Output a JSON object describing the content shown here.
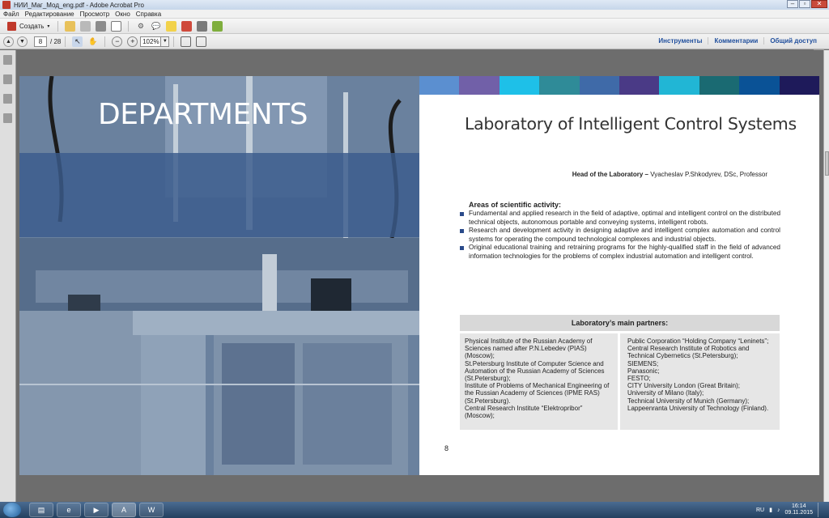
{
  "window": {
    "title": "НИИ_Маг_Мод_eng.pdf - Adobe Acrobat Pro"
  },
  "menu": [
    "Файл",
    "Редактирование",
    "Просмотр",
    "Окно",
    "Справка"
  ],
  "toolbar": {
    "create_label": "Создать"
  },
  "navigation": {
    "current_page": "8",
    "total_pages": "/ 28",
    "zoom": "102%"
  },
  "right_links": [
    "Инструменты",
    "Комментарии",
    "Общий доступ"
  ],
  "left_page": {
    "banner_text": "DEPARTMENTS"
  },
  "right_page": {
    "color_strip": [
      "#5b8fd0",
      "#7160a8",
      "#1ec0e8",
      "#2f8b98",
      "#3f6aa8",
      "#4a3a86",
      "#21b6d5",
      "#1a6a72",
      "#0a5296",
      "#1e1a5a"
    ],
    "title": "Laboratory of Intelligent Control Systems",
    "head_label": "Head of the Laboratory –",
    "head_name": "Vyacheslav P.Shkodyrev, DSc, Professor",
    "areas_title": "Areas of scientific activity:",
    "areas": [
      "Fundamental and applied research in the field of adaptive, optimal and intelligent control on the distributed technical objects, autonomous portable and conveying systems, intelligent robots.",
      "Research and development activity in designing adaptive and intelligent complex automation and control systems for operating the compound technological complexes and industrial objects.",
      "Original educational training and retraining programs for the highly-qualified staff in the field of advanced information technologies for the problems of complex industrial automation and intelligent control."
    ],
    "partners_title": "Laboratory’s main partners:",
    "partners_left": [
      "Physical Institute of the Russian Academy of Sciences named after P.N.Lebedev (PIAS) (Moscow);",
      "St.Petersburg Institute of Computer Science and Automation of the Russian Academy of Sciences (St.Petersburg);",
      "Institute of Problems of Mechanical Engineering of the Russian Academy of Sciences (IPME RAS) (St.Petersburg).",
      "Central Research Institute “Elektropribor” (Moscow);"
    ],
    "partners_right": [
      "Public Corporation “Holding Company “Leninets”;",
      "Central Research Institute of Robotics and Technical Cybernetics (St.Petersburg);",
      "SIEMENS;",
      "Panasonic;",
      "FESTO;",
      "CITY University London (Great Britain);",
      "University of Milano (Italy);",
      "Technical University of Munich (Germany);",
      "Lappeenranta University of Technology (Finland)."
    ],
    "page_number": "8"
  },
  "taskbar": {
    "lang": "RU",
    "time": "16:14",
    "date": "09.11.2015"
  }
}
